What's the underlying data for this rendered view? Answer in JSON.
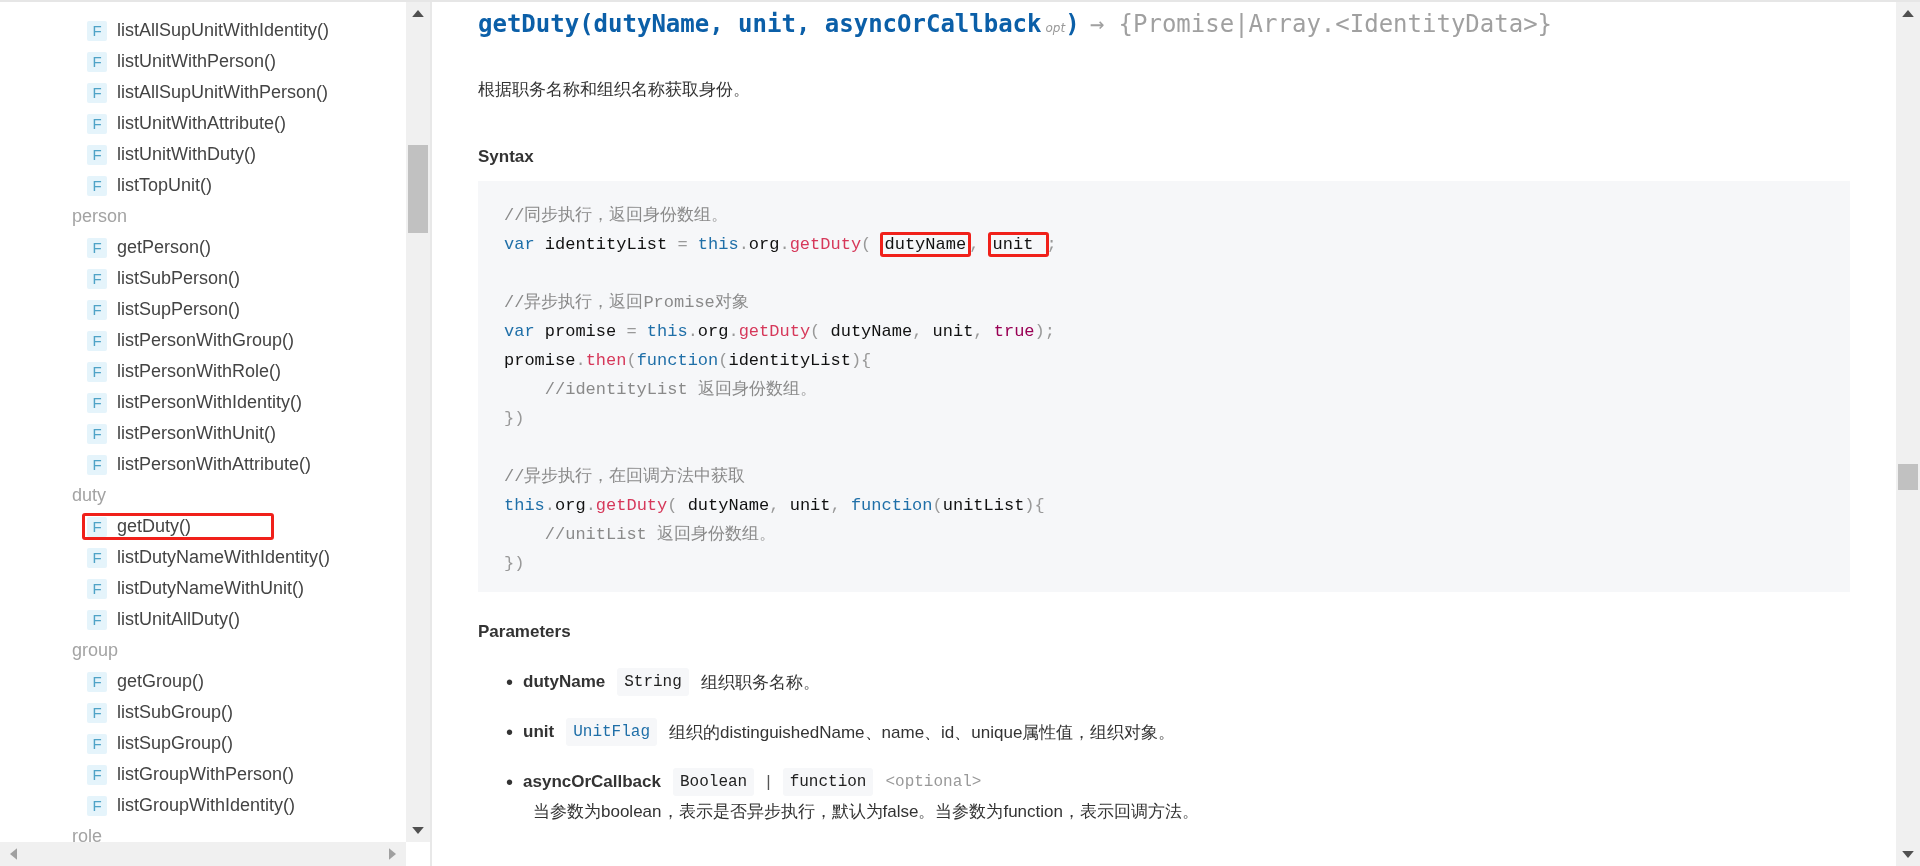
{
  "sidebar": {
    "groups": [
      {
        "items": [
          {
            "badge": "F",
            "label": "listAllSupUnitWithIdentity()",
            "highlighted": false
          },
          {
            "badge": "F",
            "label": "listUnitWithPerson()",
            "highlighted": false
          },
          {
            "badge": "F",
            "label": "listAllSupUnitWithPerson()",
            "highlighted": false
          },
          {
            "badge": "F",
            "label": "listUnitWithAttribute()",
            "highlighted": false
          },
          {
            "badge": "F",
            "label": "listUnitWithDuty()",
            "highlighted": false
          },
          {
            "badge": "F",
            "label": "listTopUnit()",
            "highlighted": false
          }
        ]
      },
      {
        "label": "person",
        "items": [
          {
            "badge": "F",
            "label": "getPerson()",
            "highlighted": false
          },
          {
            "badge": "F",
            "label": "listSubPerson()",
            "highlighted": false
          },
          {
            "badge": "F",
            "label": "listSupPerson()",
            "highlighted": false
          },
          {
            "badge": "F",
            "label": "listPersonWithGroup()",
            "highlighted": false
          },
          {
            "badge": "F",
            "label": "listPersonWithRole()",
            "highlighted": false
          },
          {
            "badge": "F",
            "label": "listPersonWithIdentity()",
            "highlighted": false
          },
          {
            "badge": "F",
            "label": "listPersonWithUnit()",
            "highlighted": false
          },
          {
            "badge": "F",
            "label": "listPersonWithAttribute()",
            "highlighted": false
          }
        ]
      },
      {
        "label": "duty",
        "items": [
          {
            "badge": "F",
            "label": "getDuty()",
            "highlighted": true
          },
          {
            "badge": "F",
            "label": "listDutyNameWithIdentity()",
            "highlighted": false
          },
          {
            "badge": "F",
            "label": "listDutyNameWithUnit()",
            "highlighted": false
          },
          {
            "badge": "F",
            "label": "listUnitAllDuty()",
            "highlighted": false
          }
        ]
      },
      {
        "label": "group",
        "items": [
          {
            "badge": "F",
            "label": "getGroup()",
            "highlighted": false
          },
          {
            "badge": "F",
            "label": "listSubGroup()",
            "highlighted": false
          },
          {
            "badge": "F",
            "label": "listSupGroup()",
            "highlighted": false
          },
          {
            "badge": "F",
            "label": "listGroupWithPerson()",
            "highlighted": false
          },
          {
            "badge": "F",
            "label": "listGroupWithIdentity()",
            "highlighted": false
          }
        ]
      },
      {
        "label": "role"
      }
    ]
  },
  "doc": {
    "title": "getDuty(dutyName, unit, asyncOrCallback$_{opt}$)",
    "returns": "→ {Promise|Array.<IdentityData>}",
    "description": "根据职务名称和组织名称获取身份。",
    "syntax_heading": "Syntax",
    "code_blocks": [
      [
        [
          {
            "text": "//同步执行，返回身份数组。",
            "kind": "comment"
          }
        ],
        [
          {
            "text": "var",
            "kind": "keyword"
          },
          {
            "text": " identityList ",
            "kind": "plain"
          },
          {
            "text": "= ",
            "kind": "punct"
          },
          {
            "text": "this",
            "kind": "keyword"
          },
          {
            "text": ".",
            "kind": "punct"
          },
          {
            "text": "org",
            "kind": "plain"
          },
          {
            "text": ".",
            "kind": "punct"
          },
          {
            "text": "getDuty",
            "kind": "method"
          },
          {
            "text": "( ",
            "kind": "punct"
          },
          {
            "text": "dutyName",
            "kind": "plain",
            "highlighted": true
          },
          {
            "text": ", ",
            "kind": "punct"
          },
          {
            "text": "unit ",
            "kind": "plain",
            "highlighted": true
          },
          {
            "text": ";",
            "kind": "punct"
          }
        ]
      ],
      [
        [
          {
            "text": "//异步执行，返回Promise对象",
            "kind": "comment"
          }
        ],
        [
          {
            "text": "var",
            "kind": "keyword"
          },
          {
            "text": " promise ",
            "kind": "plain"
          },
          {
            "text": "= ",
            "kind": "punct"
          },
          {
            "text": "this",
            "kind": "keyword"
          },
          {
            "text": ".",
            "kind": "punct"
          },
          {
            "text": "org",
            "kind": "plain"
          },
          {
            "text": ".",
            "kind": "punct"
          },
          {
            "text": "getDuty",
            "kind": "method"
          },
          {
            "text": "( ",
            "kind": "punct"
          },
          {
            "text": "dutyName",
            "kind": "plain"
          },
          {
            "text": ", ",
            "kind": "punct"
          },
          {
            "text": "unit",
            "kind": "plain"
          },
          {
            "text": ", ",
            "kind": "punct"
          },
          {
            "text": "true",
            "kind": "literal"
          },
          {
            "text": ");",
            "kind": "punct"
          }
        ],
        [
          {
            "text": "promise",
            "kind": "plain"
          },
          {
            "text": ".",
            "kind": "punct"
          },
          {
            "text": "then",
            "kind": "method"
          },
          {
            "text": "(",
            "kind": "punct"
          },
          {
            "text": "function",
            "kind": "keyword"
          },
          {
            "text": "(",
            "kind": "punct"
          },
          {
            "text": "identityList",
            "kind": "plain"
          },
          {
            "text": "){",
            "kind": "punct"
          }
        ],
        [
          {
            "text": "    //identityList 返回身份数组。",
            "kind": "comment"
          }
        ],
        [
          {
            "text": "})",
            "kind": "punct"
          }
        ]
      ],
      [
        [
          {
            "text": "//异步执行，在回调方法中获取",
            "kind": "comment"
          }
        ],
        [
          {
            "text": "this",
            "kind": "keyword"
          },
          {
            "text": ".",
            "kind": "punct"
          },
          {
            "text": "org",
            "kind": "plain"
          },
          {
            "text": ".",
            "kind": "punct"
          },
          {
            "text": "getDuty",
            "kind": "method"
          },
          {
            "text": "( ",
            "kind": "punct"
          },
          {
            "text": "dutyName",
            "kind": "plain"
          },
          {
            "text": ", ",
            "kind": "punct"
          },
          {
            "text": "unit",
            "kind": "plain"
          },
          {
            "text": ", ",
            "kind": "punct"
          },
          {
            "text": "function",
            "kind": "keyword"
          },
          {
            "text": "(",
            "kind": "punct"
          },
          {
            "text": "unitList",
            "kind": "plain"
          },
          {
            "text": "){",
            "kind": "punct"
          }
        ],
        [
          {
            "text": "    //unitList 返回身份数组。",
            "kind": "comment"
          }
        ],
        [
          {
            "text": "})",
            "kind": "punct"
          }
        ]
      ]
    ],
    "parameters_heading": "Parameters",
    "parameters": [
      {
        "bullet": "•",
        "name": "dutyName",
        "types": [
          {
            "text": "String",
            "kind": "plain"
          }
        ],
        "description": "组织职务名称。"
      },
      {
        "bullet": "•",
        "name": "unit",
        "types": [
          {
            "text": "UnitFlag",
            "kind": "link"
          }
        ],
        "description": "组织的distinguishedName、name、id、unique属性值，组织对象。"
      },
      {
        "bullet": "•",
        "name": "asyncOrCallback",
        "types": [
          {
            "text": "Boolean",
            "kind": "plain"
          },
          {
            "text": "function",
            "kind": "plain"
          }
        ],
        "separator": "|",
        "optional": "<optional>",
        "note": "当参数为boolean，表示是否异步执行，默认为false。当参数为function，表示回调方法。"
      }
    ]
  }
}
